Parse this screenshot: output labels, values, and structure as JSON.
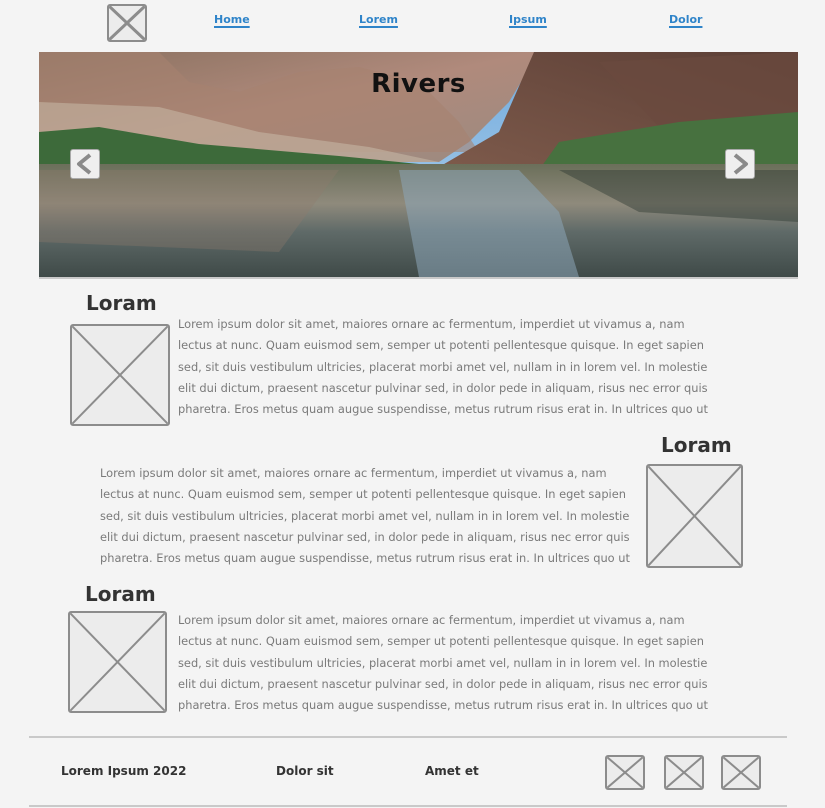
{
  "nav": {
    "logo_icon": "image-placeholder-icon",
    "links": [
      "Home",
      "Lorem",
      "Ipsum",
      "Dolor"
    ]
  },
  "hero": {
    "title": "Rivers",
    "prev_icon": "chevron-left-icon",
    "next_icon": "chevron-right-icon"
  },
  "sections": [
    {
      "title": "Loram",
      "text": "Lorem ipsum dolor sit amet, maiores ornare ac fermentum, imperdiet ut vivamus a, nam\nlectus at nunc. Quam euismod sem, semper ut potenti pellentesque quisque. In eget sapien\nsed, sit duis vestibulum ultricies, placerat morbi amet vel, nullam in in lorem vel. In molestie\nelit dui dictum, praesent nascetur pulvinar sed, in dolor pede in aliquam, risus nec error quis\npharetra. Eros metus quam augue suspendisse, metus rutrum risus erat in.  In ultrices quo ut"
    },
    {
      "title": "Loram",
      "text": "Lorem ipsum dolor sit amet, maiores ornare ac fermentum, imperdiet ut vivamus a, nam\nlectus at nunc. Quam euismod sem, semper ut potenti pellentesque quisque. In eget sapien\nsed, sit duis vestibulum ultricies, placerat morbi amet vel, nullam in in lorem vel. In molestie\nelit dui dictum, praesent nascetur pulvinar sed, in dolor pede in aliquam, risus nec error quis\npharetra. Eros metus quam augue suspendisse, metus rutrum risus erat in.  In ultrices quo ut"
    },
    {
      "title": "Loram",
      "text": "Lorem ipsum dolor sit amet, maiores ornare ac fermentum, imperdiet ut vivamus a, nam\nlectus at nunc. Quam euismod sem, semper ut potenti pellentesque quisque. In eget sapien\nsed, sit duis vestibulum ultricies, placerat morbi amet vel, nullam in in lorem vel. In molestie\nelit dui dictum, praesent nascetur pulvinar sed, in dolor pede in aliquam, risus nec error quis\npharetra. Eros metus quam augue suspendisse, metus rutrum risus erat in.  In ultrices quo ut"
    }
  ],
  "footer": {
    "copyright": "Lorem Ipsum 2022",
    "link1": "Dolor sit",
    "link2": "Amet et",
    "social_icons": [
      "image-placeholder-icon",
      "image-placeholder-icon",
      "image-placeholder-icon"
    ]
  },
  "colors": {
    "background": "#f4f4f4",
    "link": "#2f84c9",
    "placeholder_border": "#8c8c8c",
    "body_text": "#7a7a7a"
  }
}
